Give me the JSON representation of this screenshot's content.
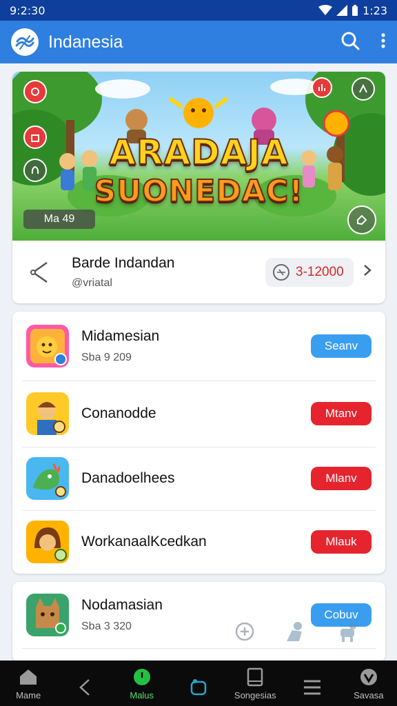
{
  "status_bar": {
    "time_left": "9:2:30",
    "time_right": "1:23"
  },
  "app_bar": {
    "title": "Indanesia",
    "logo_icon": "swirl-logo-icon",
    "search_icon": "search-icon",
    "menu_icon": "more-vertical-icon"
  },
  "banner": {
    "title_line1": "ARADAJA",
    "title_line2": "SUONEDAC!",
    "badge": "Ma 49",
    "colors": {
      "title1": "#ffd21c",
      "title2": "#ff9a1f"
    }
  },
  "banner_info": {
    "title": "Barde Indandan",
    "subtitle": "@vriatal",
    "price": "3-12000",
    "share_icon": "share-icon",
    "chevron_icon": "chevron-right-icon"
  },
  "list": [
    {
      "title": "Midamesian",
      "subtitle": "Sba 9 209",
      "button": "Seanv",
      "button_color": "#3a9ef0"
    },
    {
      "title": "Conanodde",
      "subtitle": "",
      "button": "Mtanv",
      "button_color": "#e5242e"
    },
    {
      "title": "Danadoelhees",
      "subtitle": "",
      "button": "Mlanv",
      "button_color": "#e5242e"
    },
    {
      "title": "WorkanaalKcedkan",
      "subtitle": "",
      "button": "Mlauk",
      "button_color": "#e5242e"
    }
  ],
  "list2": [
    {
      "title": "Nodamasian",
      "subtitle": "Sba 3 320",
      "button": "Cobuv",
      "button_color": "#3a9ef0"
    }
  ],
  "bottom_nav": [
    {
      "label": "Mame",
      "icon": "home-icon"
    },
    {
      "label": "",
      "icon": "back-icon"
    },
    {
      "label": "Malus",
      "icon": "circle-icon",
      "active": true
    },
    {
      "label": "",
      "icon": "tag-icon"
    },
    {
      "label": "Songesias",
      "icon": "tablet-icon"
    },
    {
      "label": "",
      "icon": "menu-icon"
    },
    {
      "label": "Savasa",
      "icon": "shield-icon"
    }
  ],
  "accent": "#2f7fe0"
}
